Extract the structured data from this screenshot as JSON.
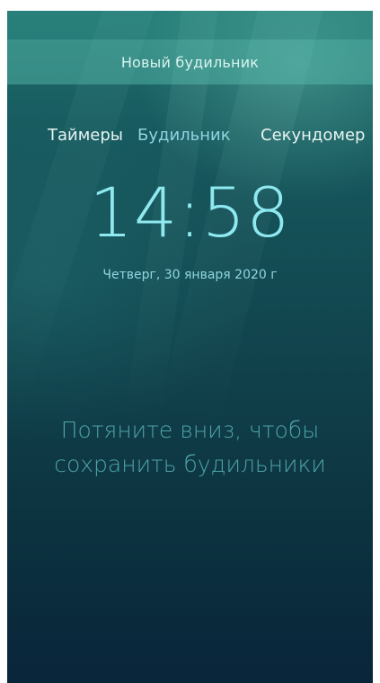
{
  "pulley_menu": {
    "new_alarm_label": "Новый будильник"
  },
  "tabs": [
    {
      "label": "Таймеры",
      "active": false
    },
    {
      "label": "Будильник",
      "active": true
    },
    {
      "label": "Секундомер",
      "active": false
    }
  ],
  "clock": {
    "time": "14:58",
    "date": "Четверг, 30 января 2020 г"
  },
  "empty_state": {
    "line1": "Потяните вниз, чтобы",
    "line2": "сохранить будильники"
  },
  "colors": {
    "accent": "#8fe9f0",
    "highlight": "#8fd6e0",
    "hint": "#4fa3a8",
    "background_top": "#1f6f6d",
    "background_bottom": "#09253a"
  }
}
